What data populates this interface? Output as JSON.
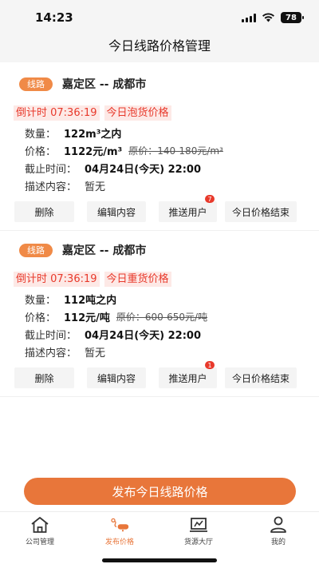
{
  "status_bar": {
    "time": "14:23",
    "battery": "78"
  },
  "header": {
    "title": "今日线路价格管理"
  },
  "cards": [
    {
      "route_tag": "线路",
      "route": "嘉定区 -- 成都市",
      "countdown": "倒计时 07:36:19",
      "price_type": "今日泡货价格",
      "qty_label": "数量：",
      "qty_value": "122m³之内",
      "price_label": "价格：",
      "price_value": "1122元/m³",
      "orig_price": "原价：140-180元/m³",
      "deadline_label": "截止时间：",
      "deadline_value": "04月24日(今天) 22:00",
      "desc_label": "描述内容：",
      "desc_value": "暂无",
      "buttons": {
        "delete": "删除",
        "edit": "编辑内容",
        "push": "推送用户",
        "push_badge": "7",
        "end": "今日价格结束"
      }
    },
    {
      "route_tag": "线路",
      "route": "嘉定区 -- 成都市",
      "countdown": "倒计时 07:36:19",
      "price_type": "今日重货价格",
      "qty_label": "数量：",
      "qty_value": "112吨之内",
      "price_label": "价格：",
      "price_value": "112元/吨",
      "orig_price": "原价：600-650元/吨",
      "deadline_label": "截止时间：",
      "deadline_value": "04月24日(今天) 22:00",
      "desc_label": "描述内容：",
      "desc_value": "暂无",
      "buttons": {
        "delete": "删除",
        "edit": "编辑内容",
        "push": "推送用户",
        "push_badge": "1",
        "end": "今日价格结束"
      }
    }
  ],
  "publish_button": "发布今日线路价格",
  "tabbar": [
    {
      "label": "公司管理",
      "icon": "home-icon",
      "active": false
    },
    {
      "label": "发布价格",
      "icon": "publish-icon",
      "active": true
    },
    {
      "label": "货源大厅",
      "icon": "cargo-hall-icon",
      "active": false
    },
    {
      "label": "我的",
      "icon": "profile-icon",
      "active": false
    }
  ],
  "colors": {
    "accent": "#e8763a",
    "tag": "#f08a47",
    "alert": "#e8392b",
    "alert_bg": "#fde9e6"
  }
}
